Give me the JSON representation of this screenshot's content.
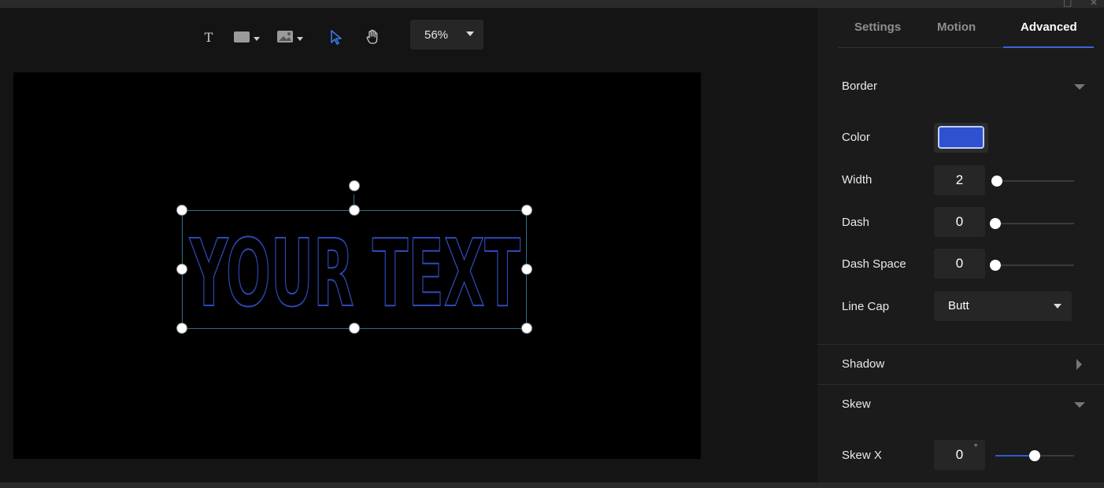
{
  "window": {
    "maximize_glyph": "□",
    "close_glyph": "✕"
  },
  "toolbar": {
    "text_tool_glyph": "T",
    "zoom_value": "56%"
  },
  "canvas": {
    "text": "YOUR TEXT",
    "stroke_color": "#2f49b8",
    "selection_color": "#2f6f8a"
  },
  "panel": {
    "tabs": [
      {
        "label": "Settings"
      },
      {
        "label": "Motion"
      },
      {
        "label": "Advanced",
        "active": true
      }
    ],
    "border": {
      "title": "Border",
      "color_label": "Color",
      "color_value": "#2f51cf",
      "width_label": "Width",
      "width_value": "2",
      "dash_label": "Dash",
      "dash_value": "0",
      "dash_space_label": "Dash Space",
      "dash_space_value": "0",
      "line_cap_label": "Line Cap",
      "line_cap_value": "Butt",
      "width_fraction": 0.02,
      "dash_fraction": 0,
      "dash_space_fraction": 0
    },
    "shadow": {
      "title": "Shadow"
    },
    "skew": {
      "title": "Skew",
      "skew_x_label": "Skew X",
      "skew_x_value": "0",
      "degree_symbol": "°",
      "skew_x_fraction": 0.5
    }
  },
  "colors": {
    "accent": "#3c63d9",
    "panel_bg": "#1b1b1b",
    "canvas_bg": "#000000"
  }
}
